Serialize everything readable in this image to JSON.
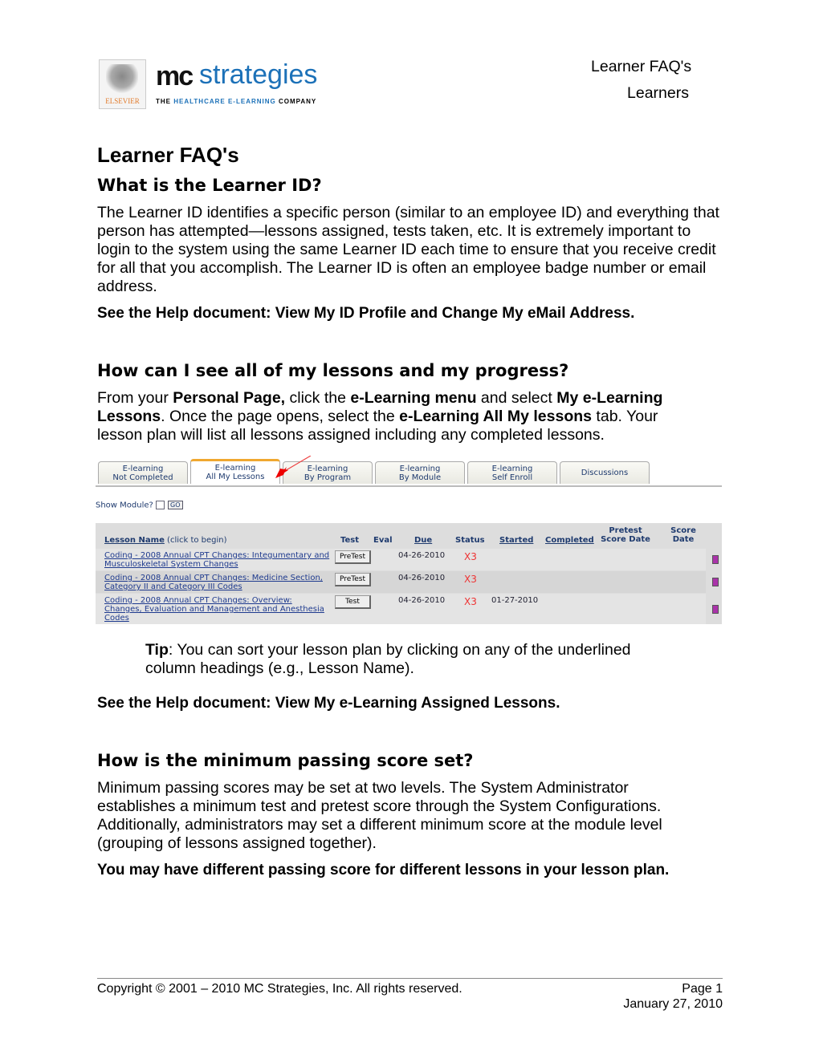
{
  "header": {
    "logo": {
      "brand_mc": "mc",
      "brand_strategies": "strategies",
      "tagline_a": "THE ",
      "tagline_b": "HEALTHCARE E-LEARNING",
      "tagline_c": " COMPANY",
      "publisher": "ELSEVIER"
    },
    "doc_title": "Learner FAQ's",
    "doc_section": "Learners"
  },
  "title": "Learner FAQ's",
  "s1": {
    "heading": "What is the Learner ID?",
    "body": "The Learner ID identifies a specific person (similar to an employee ID) and everything that person has attempted—lessons assigned, tests taken, etc. It is extremely important to login to the system using the same Learner ID each time to ensure that you receive credit for all that you accomplish. The Learner ID is often an employee badge number or email address.",
    "help": "See the Help document: View My ID Profile and Change My eMail Address."
  },
  "s2": {
    "heading": "How can I see all of my lessons and my progress?",
    "body": [
      {
        "t": "From your ",
        "b": false
      },
      {
        "t": "Personal Page,",
        "b": true
      },
      {
        "t": " click the ",
        "b": false
      },
      {
        "t": "e-Learning menu",
        "b": true
      },
      {
        "t": " and select ",
        "b": false
      },
      {
        "t": "My e-Learning Lessons",
        "b": true
      },
      {
        "t": ". Once the page opens, select the ",
        "b": false
      },
      {
        "t": "e-Learning All My lessons",
        "b": true
      },
      {
        "t": " tab. Your lesson plan will list all lessons assigned including any completed lessons.",
        "b": false
      }
    ],
    "tip_label": "Tip",
    "tip_text": ": You can sort your lesson plan by clicking on any of the underlined column headings (e.g., Lesson Name).",
    "help": "See the Help document: View My e-Learning Assigned Lessons."
  },
  "screenshot": {
    "tabs": [
      {
        "l1": "E-learning",
        "l2": "Not Completed"
      },
      {
        "l1": "E-learning",
        "l2": "All My Lessons",
        "active": true
      },
      {
        "l1": "E-learning",
        "l2": "By Program"
      },
      {
        "l1": "E-learning",
        "l2": "By Module"
      },
      {
        "l1": "E-learning",
        "l2": "Self Enroll"
      },
      {
        "l1": "Discussions",
        "l2": ""
      }
    ],
    "show_module": "Show Module?",
    "go": "GO",
    "columns": {
      "lesson": "Lesson Name",
      "lesson_hint": " (click to begin)",
      "test": "Test",
      "eval": "Eval",
      "due": "Due",
      "status": "Status",
      "started": "Started",
      "completed": "Completed",
      "pretest": "Pretest Score Date",
      "score": "Score Date"
    },
    "rows": [
      {
        "name": "Coding - 2008 Annual CPT Changes: Integumentary and Musculoskeletal System Changes",
        "test": "PreTest",
        "due": "04-26-2010",
        "status": "X3",
        "started": ""
      },
      {
        "name": "Coding - 2008 Annual CPT Changes: Medicine Section, Category II and Category III Codes",
        "test": "PreTest",
        "due": "04-26-2010",
        "status": "X3",
        "started": ""
      },
      {
        "name": "Coding - 2008 Annual CPT Changes: Overview: Changes, Evaluation and Management and Anesthesia Codes",
        "test": "Test",
        "due": "04-26-2010",
        "status": "X3",
        "started": "01-27-2010"
      }
    ]
  },
  "s3": {
    "heading": "How is the minimum passing score set?",
    "body": "Minimum passing scores may be set at two levels. The System Administrator establishes a minimum test and pretest score through the System Configurations. Additionally, administrators may set a different minimum score at the module level (grouping of lessons assigned together).",
    "note": "You may have different passing score for different lessons in your lesson plan."
  },
  "footer": {
    "copyright": "Copyright © 2001 – 2010 MC Strategies, Inc. All rights reserved.",
    "page": "Page 1",
    "date": "January 27, 2010"
  },
  "colors": {
    "brand_blue": "#1c71b8",
    "tab_accent": "#f0a830",
    "status_red": "#e33"
  }
}
